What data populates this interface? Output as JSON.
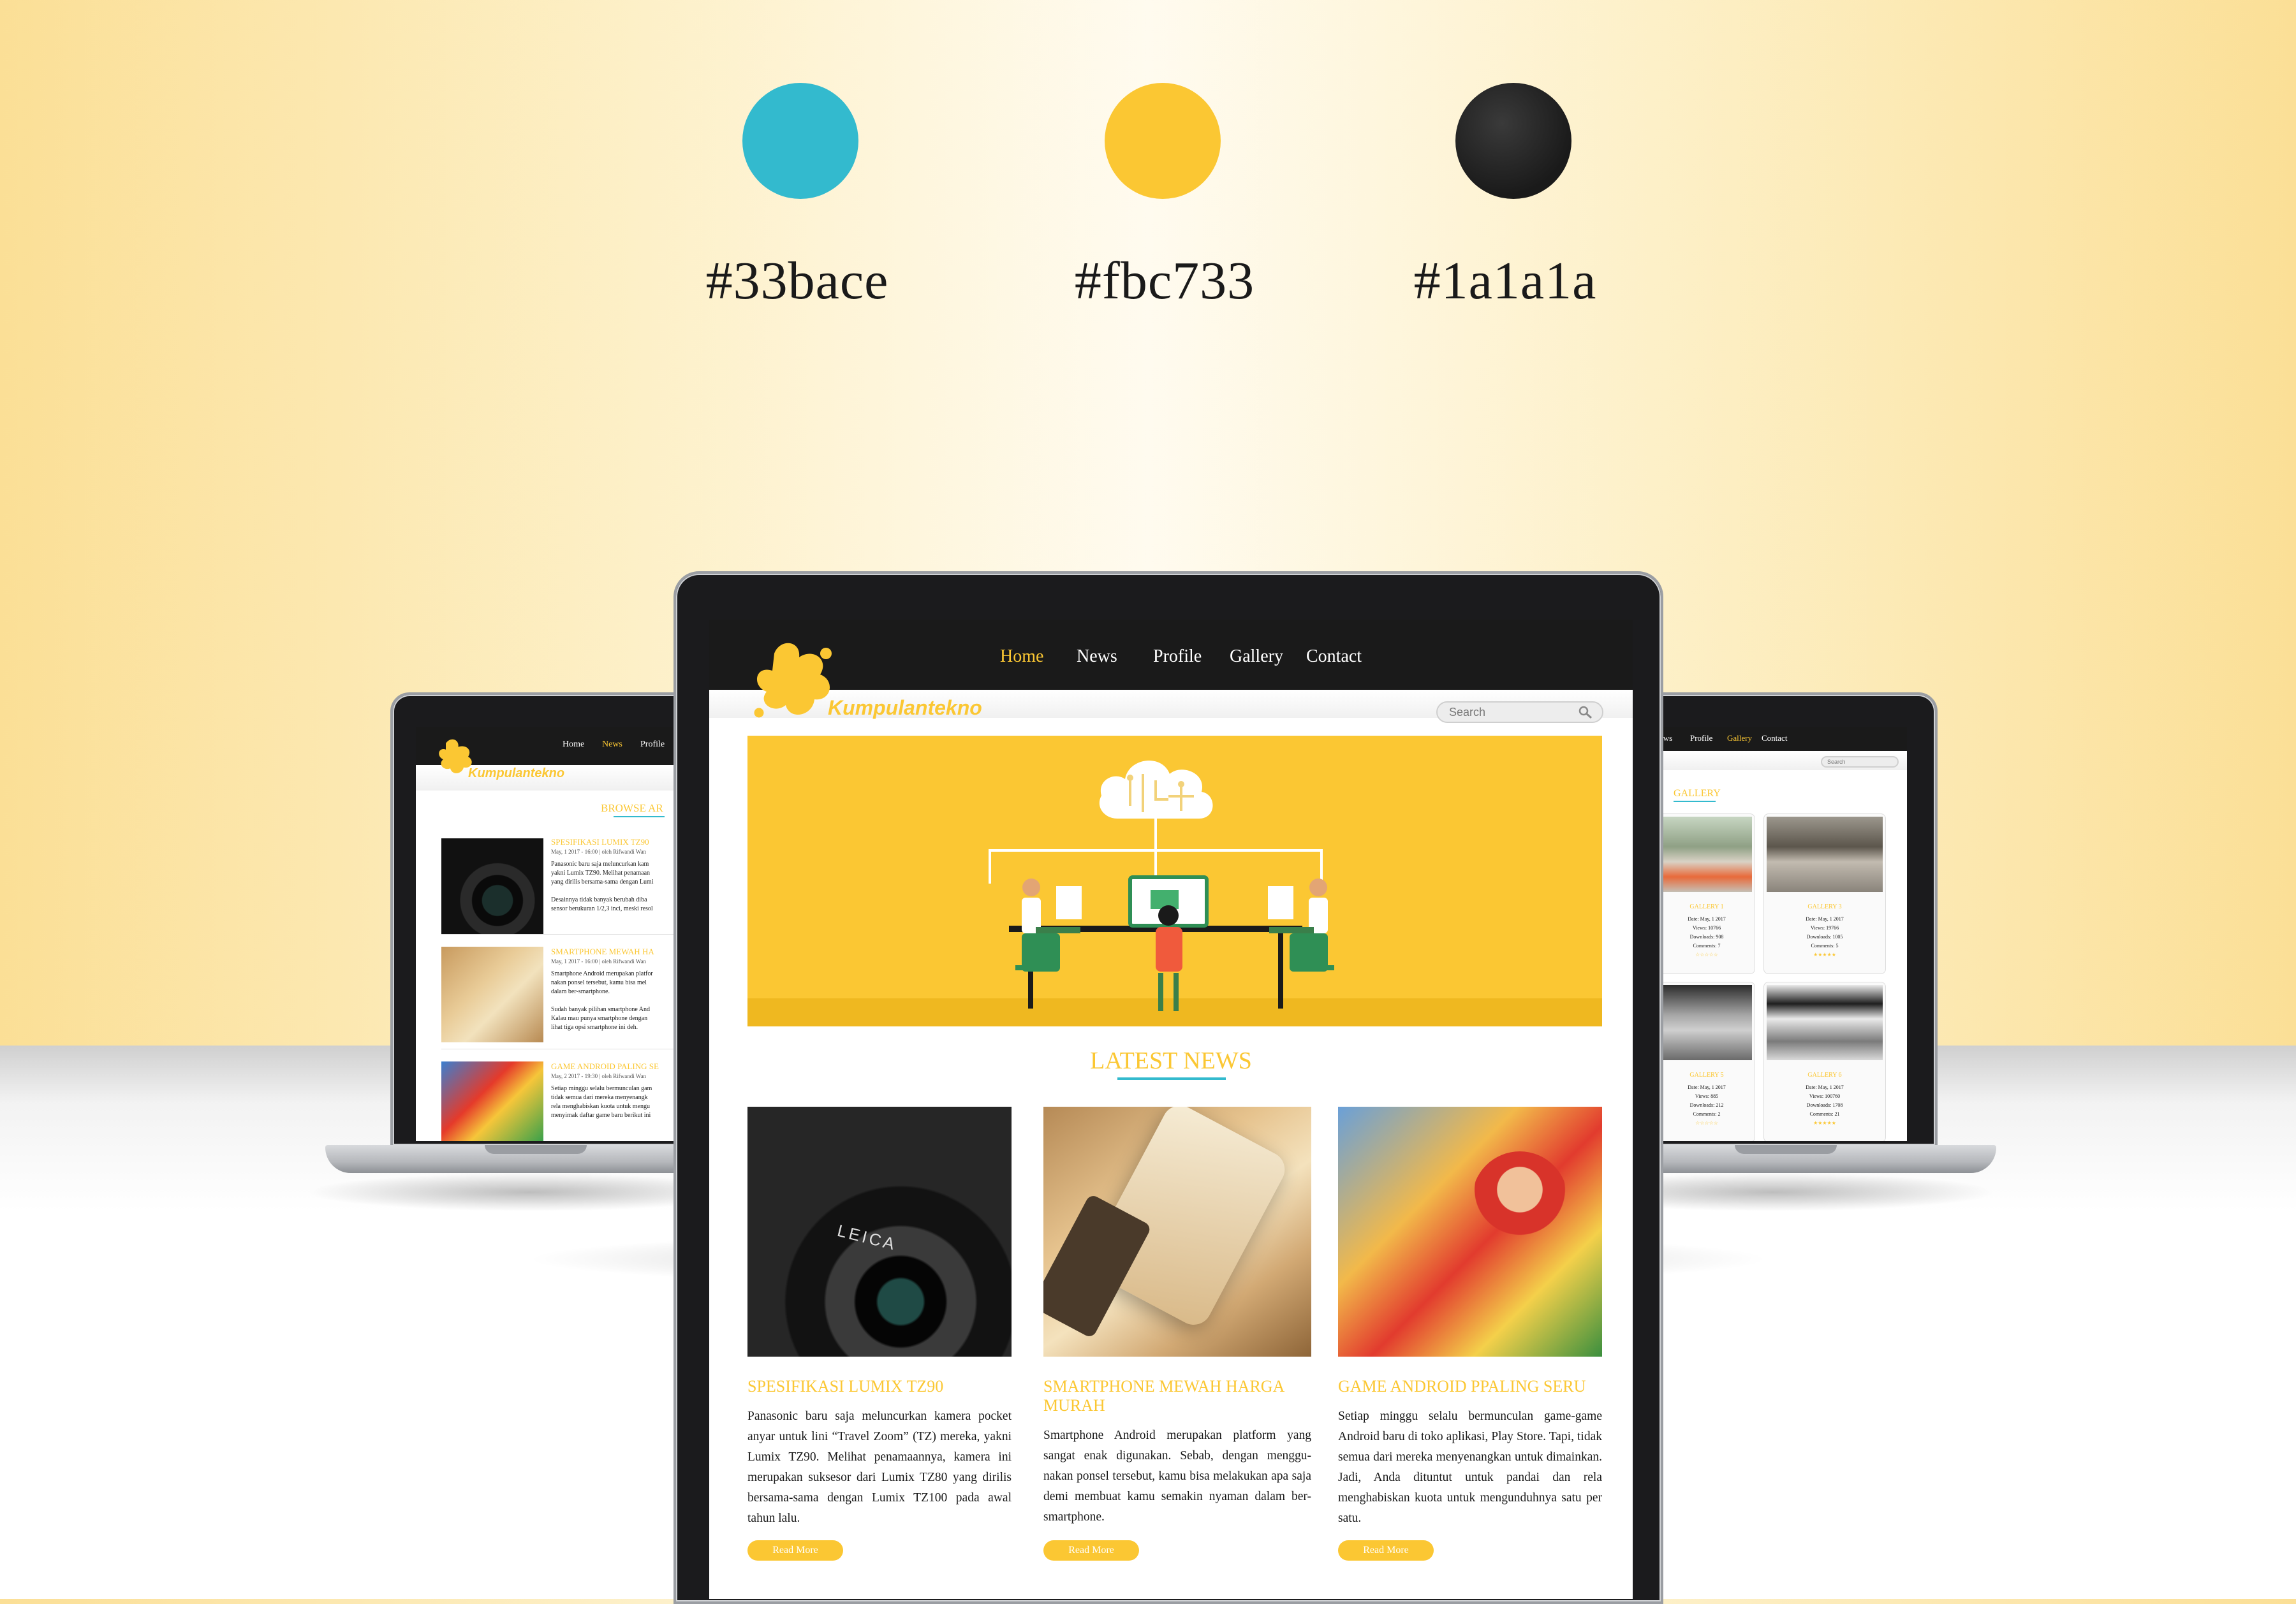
{
  "palette": [
    {
      "hex": "#33bace",
      "label": "#33bace"
    },
    {
      "hex": "#fbc733",
      "label": "#fbc733"
    },
    {
      "hex": "#1a1a1a",
      "label": "#1a1a1a"
    }
  ],
  "site": {
    "brand": "Kumpulantekno",
    "nav": [
      "Home",
      "News",
      "Profile",
      "Gallery",
      "Contact"
    ],
    "search_placeholder": "Search"
  },
  "main": {
    "active_nav": "Home",
    "section_title": "LATEST NEWS",
    "read_more": "Read More",
    "articles": [
      {
        "title": "SPESIFIKASI LUMIX TZ90",
        "text": "Panasonic baru saja meluncurkan kamera pocket anyar untuk lini “Travel Zoom” (TZ) mereka, yakni Lumix TZ90. Melihat penamaannya, kamera ini merupakan suksesor dari Lumix TZ80 yang dirilis bersama-sama dengan Lumix TZ100 pada awal tahun lalu.",
        "image": "camera"
      },
      {
        "title": "SMARTPHONE MEWAH HARGA MURAH",
        "text": "Smartphone Android merupakan platform yang sangat enak digunakan. Sebab, dengan menggu-nakan ponsel tersebut, kamu bisa melakukan apa saja demi membuat kamu semakin nyaman dalam ber-smartphone.",
        "image": "phone"
      },
      {
        "title": "GAME ANDROID PPALING SERU",
        "text": "Setiap minggu selalu bermunculan game-game Android baru di toko aplikasi, Play Store. Tapi, tidak semua dari mereka menyenangkan untuk dimainkan. Jadi, Anda dituntut untuk pandai dan rela menghabiskan kuota untuk mengunduhnya satu per satu.",
        "image": "game"
      }
    ]
  },
  "left": {
    "active_nav": "News",
    "nav": [
      "Home",
      "News",
      "Profile"
    ],
    "section_title": "BROWSE AR",
    "articles": [
      {
        "title": "SPESIFIKASI LUMIX TZ90",
        "meta": "May, 1 2017 - 16:00  |  oleh Rifwandi Wan",
        "lines": [
          "Panasonic baru saja meluncurkan kam",
          "yakni Lumix TZ90. Melihat penamaan",
          "yang dirilis bersama-sama dengan Lumi",
          "",
          "Desainnya tidak banyak berubah diba",
          "sensor berukuran 1/2,3 inci, meski resol"
        ]
      },
      {
        "title": "SMARTPHONE MEWAH HA",
        "meta": "May, 1 2017 - 16:00  |  oleh Rifwandi Wan",
        "lines": [
          "Smartphone Android merupakan platfor",
          "nakan ponsel tersebut, kamu bisa mel",
          "dalam ber-smartphone.",
          "",
          "Sudah banyak pilihan smartphone And",
          "Kalau mau punya smartphone dengan",
          "lihat tiga opsi smartphone ini deh."
        ]
      },
      {
        "title": "GAME ANDROID PALING SE",
        "meta": "May, 2 2017 - 19:30  |  oleh Rifwandi Wan",
        "lines": [
          "Setiap minggu selalu bermunculan gam",
          "tidak semua dari mereka menyenangk",
          "rela menghabiskan kuota untuk mengu",
          "menyimak daftar game baru berikut ini"
        ]
      }
    ]
  },
  "right": {
    "active_nav": "Gallery",
    "nav": [
      "ews",
      "Profile",
      "Gallery",
      "Contact"
    ],
    "section_title": "GALLERY",
    "items": [
      {
        "title": "GALLERY 1",
        "lines": [
          "Date: May, 1 2017",
          "Views: 10766",
          "Downloads: 908",
          "Comments: 7"
        ],
        "rating": "☆☆☆☆☆"
      },
      {
        "title": "GALLERY 3",
        "lines": [
          "Date: May, 1 2017",
          "Views: 19766",
          "Downloads: 1005",
          "Comments: 5"
        ],
        "rating": "★★★★★"
      },
      {
        "title": "GALLERY 5",
        "lines": [
          "Date: May, 1 2017",
          "Views: 885",
          "Downloads: 212",
          "Comments: 2"
        ],
        "rating": "☆☆☆☆☆"
      },
      {
        "title": "GALLERY 6",
        "lines": [
          "Date: May, 1 2017",
          "Views: 100760",
          "Downloads: 1708",
          "Comments: 21"
        ],
        "rating": "★★★★★"
      }
    ]
  }
}
